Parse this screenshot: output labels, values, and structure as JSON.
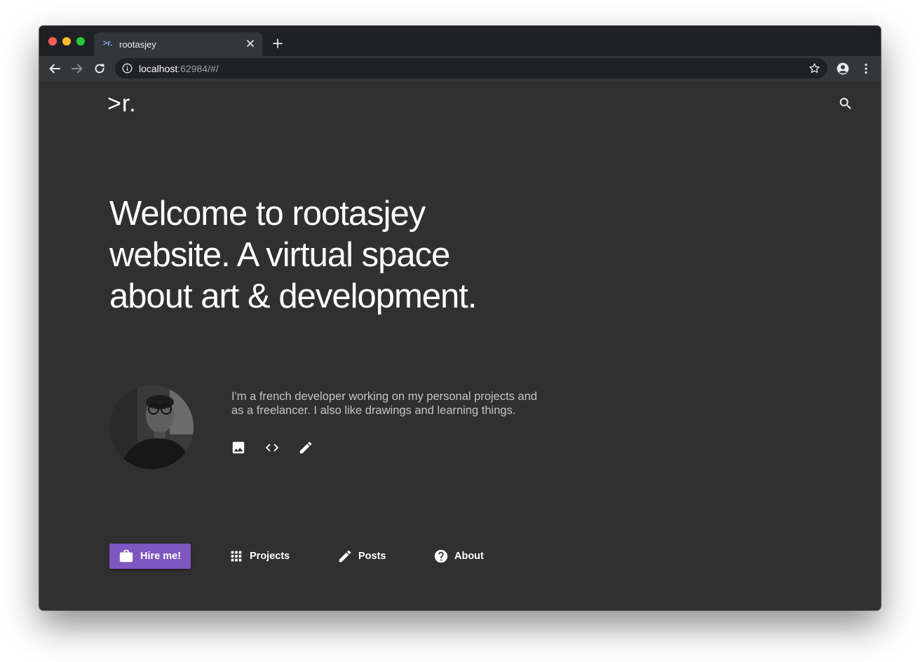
{
  "browser": {
    "tab": {
      "favicon_text": ">r.",
      "title": "rootasjey"
    },
    "address": {
      "host": "localhost",
      "rest": ":62984/#/"
    },
    "icons": [
      "close-icon",
      "plus-icon",
      "back-arrow-icon",
      "forward-arrow-icon",
      "reload-icon",
      "info-icon",
      "star-icon",
      "account-circle-icon",
      "more-vert-icon"
    ]
  },
  "site": {
    "logo": ">r.",
    "hero_title": "Welcome to rootasjey website. A virtual space about art & development.",
    "bio": "I'm a french developer working on my personal projects and as a freelancer. I also like drawings and learning things.",
    "bio_icons": [
      "image-icon",
      "code-icon",
      "pencil-icon"
    ],
    "cta_label": "Hire me!",
    "nav": [
      {
        "label": "Projects",
        "icon": "apps-grid-icon"
      },
      {
        "label": "Posts",
        "icon": "pencil-icon"
      },
      {
        "label": "About",
        "icon": "help-circle-icon"
      }
    ]
  },
  "colors": {
    "page_background": "#303031",
    "tab_strip": "#202124",
    "toolbar": "#35363a",
    "accent": "#7e57c2",
    "text_primary": "#ffffff",
    "text_secondary": "#c4c4c4"
  }
}
